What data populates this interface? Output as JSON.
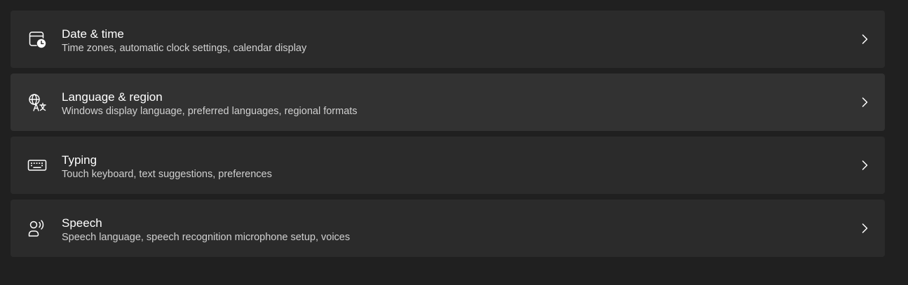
{
  "settings_items": [
    {
      "title": "Date & time",
      "subtitle": "Time zones, automatic clock settings, calendar display",
      "icon": "calendar-clock-icon"
    },
    {
      "title": "Language & region",
      "subtitle": "Windows display language, preferred languages, regional formats",
      "icon": "globe-language-icon"
    },
    {
      "title": "Typing",
      "subtitle": "Touch keyboard, text suggestions, preferences",
      "icon": "keyboard-icon"
    },
    {
      "title": "Speech",
      "subtitle": "Speech language, speech recognition microphone setup, voices",
      "icon": "speech-icon"
    }
  ],
  "colors": {
    "background": "#202020",
    "card": "#2b2b2b",
    "card_hover": "#323232",
    "text_primary": "#ffffff",
    "text_secondary": "#d0d0d0"
  }
}
